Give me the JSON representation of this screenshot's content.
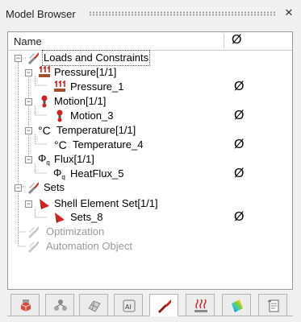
{
  "window": {
    "title": "Model Browser",
    "close_glyph": "✕"
  },
  "columns": {
    "name": "Name",
    "state_icon": "Ø"
  },
  "tree": {
    "loads": "Loads and Constraints",
    "pressure": "Pressure[1/1]",
    "pressure_1": "Pressure_1",
    "motion": "Motion[1/1]",
    "motion_3": "Motion_3",
    "temperature": "Temperature[1/1]",
    "temperature_4": "Temperature_4",
    "flux": "Flux[1/1]",
    "heatflux_5": "HeatFlux_5",
    "sets": "Sets",
    "shell_set": "Shell Element Set[1/1]",
    "sets_8": "Sets_8",
    "optimization": "Optimization",
    "automation": "Automation Object"
  },
  "glyphs": {
    "minus": "−",
    "state": "Ø",
    "degc": "°C",
    "phi": "Φ",
    "phi_sub": "q"
  },
  "tabs": [
    "parts-tab",
    "assembly-tab",
    "mesh-tab",
    "ai-tab",
    "loads-tab",
    "heat-tab",
    "results-tab",
    "report-tab"
  ],
  "colors": {
    "accent_red": "#d42020",
    "pressure_brown": "#a5502c",
    "background": "#f0f0f0"
  }
}
